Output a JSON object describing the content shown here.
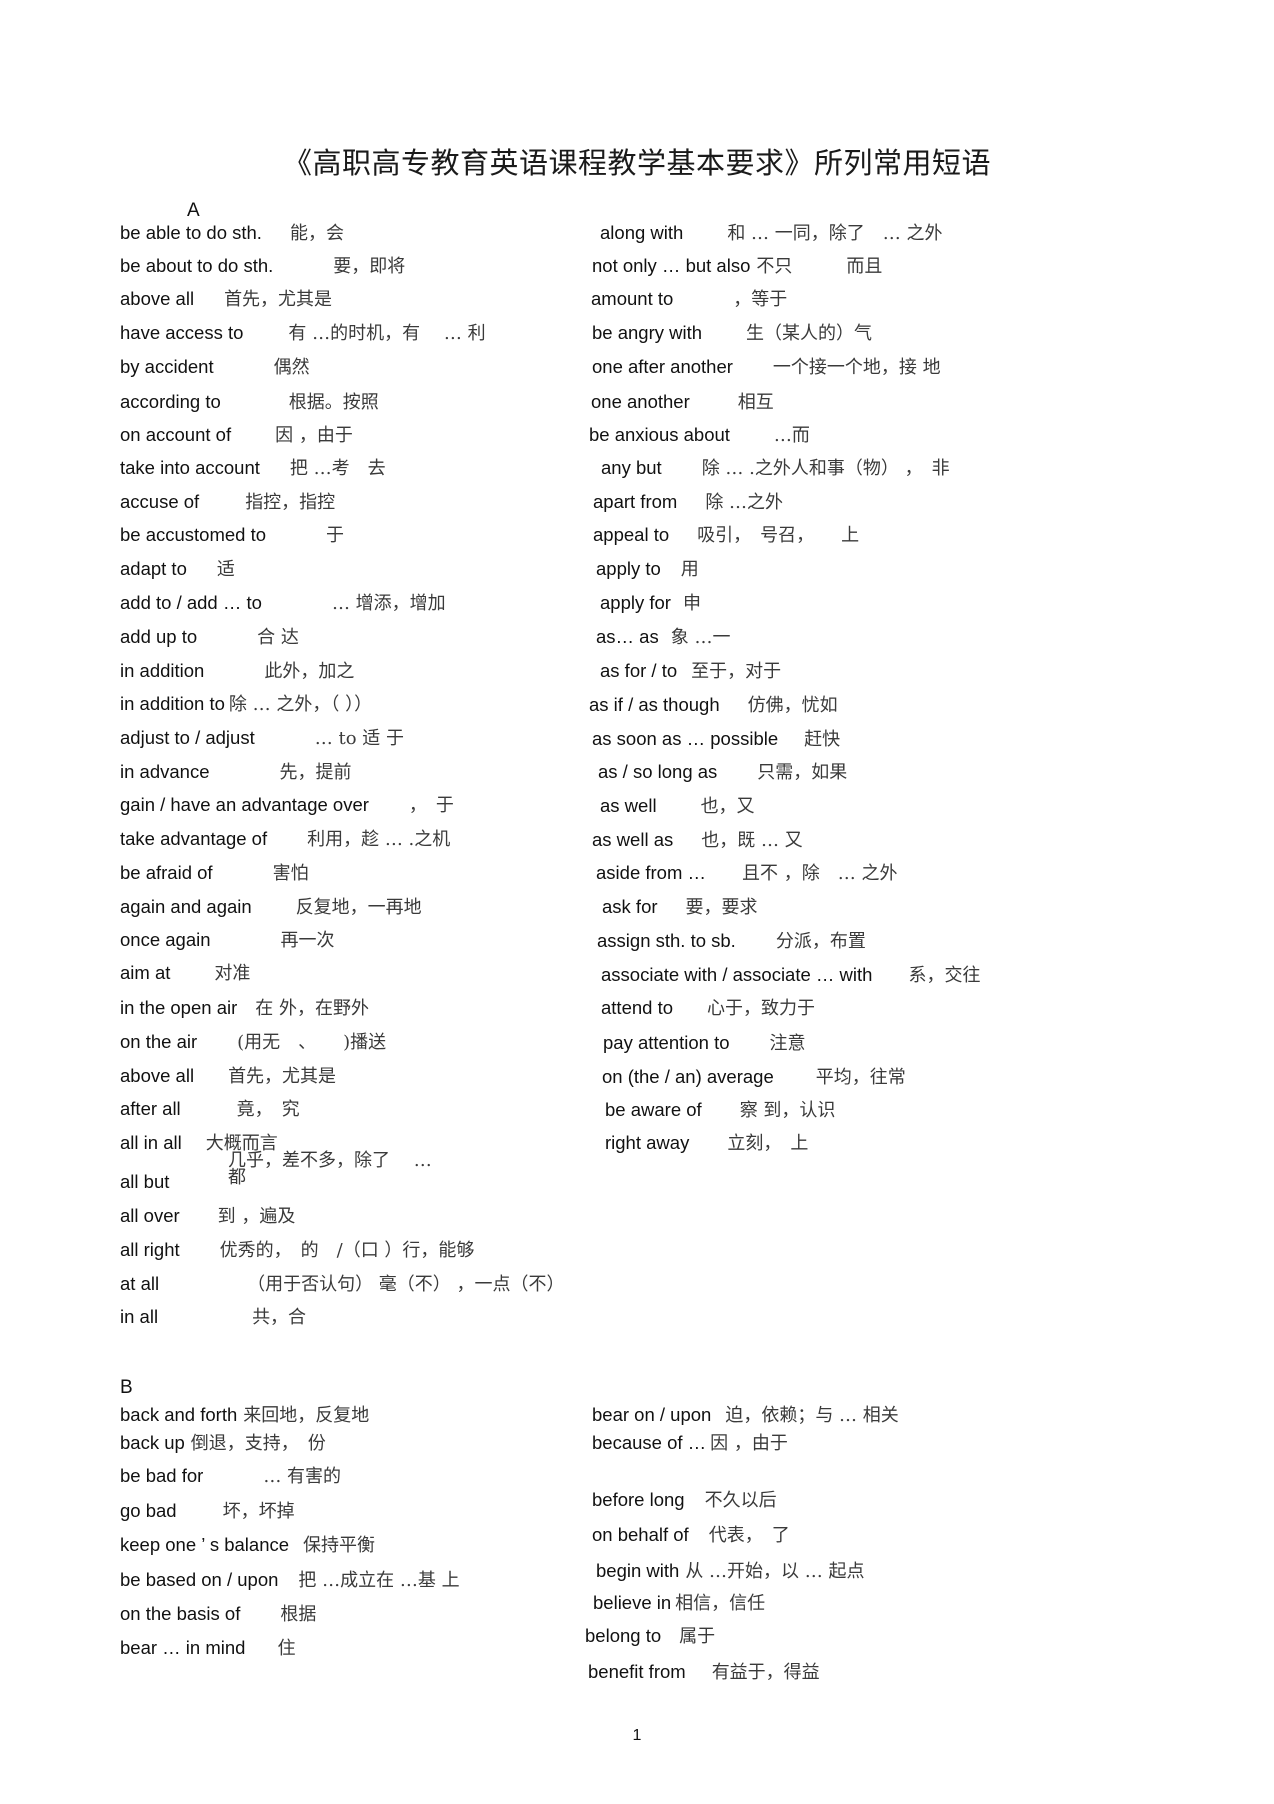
{
  "document": {
    "title": "《高职高专教育英语课程教学基本要求》所列常用短语",
    "page_number": "1"
  },
  "sections": {
    "A": {
      "letter": "A",
      "left": [
        {
          "en": "be able to do sth.",
          "zh": "能，会"
        },
        {
          "en": "be about to do sth.",
          "zh": "要，即将"
        },
        {
          "en": "above all",
          "zh": "首先，尤其是"
        },
        {
          "en": "have access to",
          "zh": "有 …的时机，有 　… 利"
        },
        {
          "en": "by accident",
          "zh": "偶然"
        },
        {
          "en": "according to",
          "zh": "根据。按照"
        },
        {
          "en": "on account of",
          "zh": "因 ，由于"
        },
        {
          "en": "take into account",
          "zh": "把 …考　去"
        },
        {
          "en": "accuse of",
          "zh": "指控，指控"
        },
        {
          "en": "be accustomed to",
          "zh": "于"
        },
        {
          "en": "adapt to",
          "zh": "适"
        },
        {
          "en": "add to / add … to",
          "zh": "… 增添，增加"
        },
        {
          "en": "add up to",
          "zh": "合 达"
        },
        {
          "en": "in addition",
          "zh": "此外，加之"
        },
        {
          "en": "in addition to",
          "zh": "除 … 之外，（ ））"
        },
        {
          "en": "adjust to / adjust",
          "zh": "… to 适 于"
        },
        {
          "en": "in advance",
          "zh": "先，提前"
        },
        {
          "en": "gain / have an advantage over",
          "zh": "，　于"
        },
        {
          "en": "take advantage of",
          "zh": "利用，趁 … .之机"
        },
        {
          "en": "be afraid of",
          "zh": "害怕"
        },
        {
          "en": "again and again",
          "zh": "反复地，一再地"
        },
        {
          "en": "once again",
          "zh": "再一次"
        },
        {
          "en": "aim at",
          "zh": "对准"
        },
        {
          "en": "in the open air",
          "zh": "在 外，在野外"
        },
        {
          "en": "on the air",
          "zh": "(用无　、　　)播送"
        },
        {
          "en": "above all",
          "zh": "首先，尤其是"
        },
        {
          "en": "after all",
          "zh": "竟，　究"
        },
        {
          "en": "all in all",
          "zh": "大概而言"
        },
        {
          "en": "all but",
          "zh": "都",
          "zh_above": "几乎，差不多，除了　 …"
        },
        {
          "en": "all over",
          "zh": "到 ，遍及"
        },
        {
          "en": "all right",
          "zh": "优秀的，　的　/（口 ）行，能够"
        },
        {
          "en": "at all",
          "zh": "（用于否认句） 毫（不） ，一点（不）"
        },
        {
          "en": "in all",
          "zh": "共，合"
        }
      ],
      "right": [
        {
          "en": "along with",
          "zh": "和 … 一同，除了　… 之外"
        },
        {
          "en": "not only … but also",
          "zh": "不只　　　而且"
        },
        {
          "en": "amount to",
          "zh": "，等于"
        },
        {
          "en": "be angry with",
          "zh": "生（某人的）气"
        },
        {
          "en": "one after another",
          "zh": "一个接一个地，接 地"
        },
        {
          "en": "one another",
          "zh": "相互"
        },
        {
          "en": "be anxious about",
          "zh": "…而"
        },
        {
          "en": "any but",
          "zh": "除 … .之外人和事（物） ，　非"
        },
        {
          "en": "apart from",
          "zh": "除 …之外"
        },
        {
          "en": "appeal to",
          "zh": "吸引，　号召，　　上"
        },
        {
          "en": "apply to",
          "zh": "用"
        },
        {
          "en": "apply for",
          "zh": "申"
        },
        {
          "en": "as… as",
          "zh": "象 …一"
        },
        {
          "en": "as for / to",
          "zh": "至于，对于"
        },
        {
          "en": "as if / as though",
          "zh": "仿佛，忧如"
        },
        {
          "en": "as soon as … possible",
          "zh": "赶快"
        },
        {
          "en": "as / so long as",
          "zh": "只需，如果"
        },
        {
          "en": "as well",
          "zh": "也，又"
        },
        {
          "en": "as well as",
          "zh": "也，既 … 又"
        },
        {
          "en": "aside from …",
          "zh": "且不 ，除　… 之外"
        },
        {
          "en": "ask for",
          "zh": "要，要求"
        },
        {
          "en": "assign sth. to sb.",
          "zh": "分派，布置"
        },
        {
          "en": "associate with / associate … with",
          "zh": "系，交往"
        },
        {
          "en": "attend to",
          "zh": "心于，致力于"
        },
        {
          "en": "pay attention to",
          "zh": "注意"
        },
        {
          "en": "on (the / an) average",
          "zh": "平均，往常"
        },
        {
          "en": "be aware of",
          "zh": "察 到，认识"
        },
        {
          "en": "right away",
          "zh": "立刻，　上"
        }
      ]
    },
    "B": {
      "letter": "B",
      "left": [
        {
          "en": "back and forth",
          "zh": "来回地，反复地"
        },
        {
          "en": "back up",
          "zh": "倒退，支持，　份"
        },
        {
          "en": "be bad for",
          "zh": "… 有害的"
        },
        {
          "en": "go bad",
          "zh": "坏，坏掉"
        },
        {
          "en": "keep one ’ s balance",
          "zh": "保持平衡"
        },
        {
          "en": "be based on / upon",
          "zh": "把 …成立在 …基 上"
        },
        {
          "en": "on the basis of",
          "zh": "根据"
        },
        {
          "en": "bear … in mind",
          "zh": "住"
        }
      ],
      "right": [
        {
          "en": "bear on / upon",
          "zh": "迫，依赖；与 … 相关"
        },
        {
          "en": "because of …",
          "zh": "因 ，由于"
        },
        {
          "en": "before long",
          "zh": "不久以后"
        },
        {
          "en": "on behalf of",
          "zh": "代表，　了"
        },
        {
          "en": "begin with",
          "zh": "从 …开始，以 … 起点"
        },
        {
          "en": "believe in",
          "zh": "相信，信任"
        },
        {
          "en": "belong to",
          "zh": "属于"
        },
        {
          "en": "benefit from",
          "zh": "有益于，得益"
        }
      ]
    }
  }
}
